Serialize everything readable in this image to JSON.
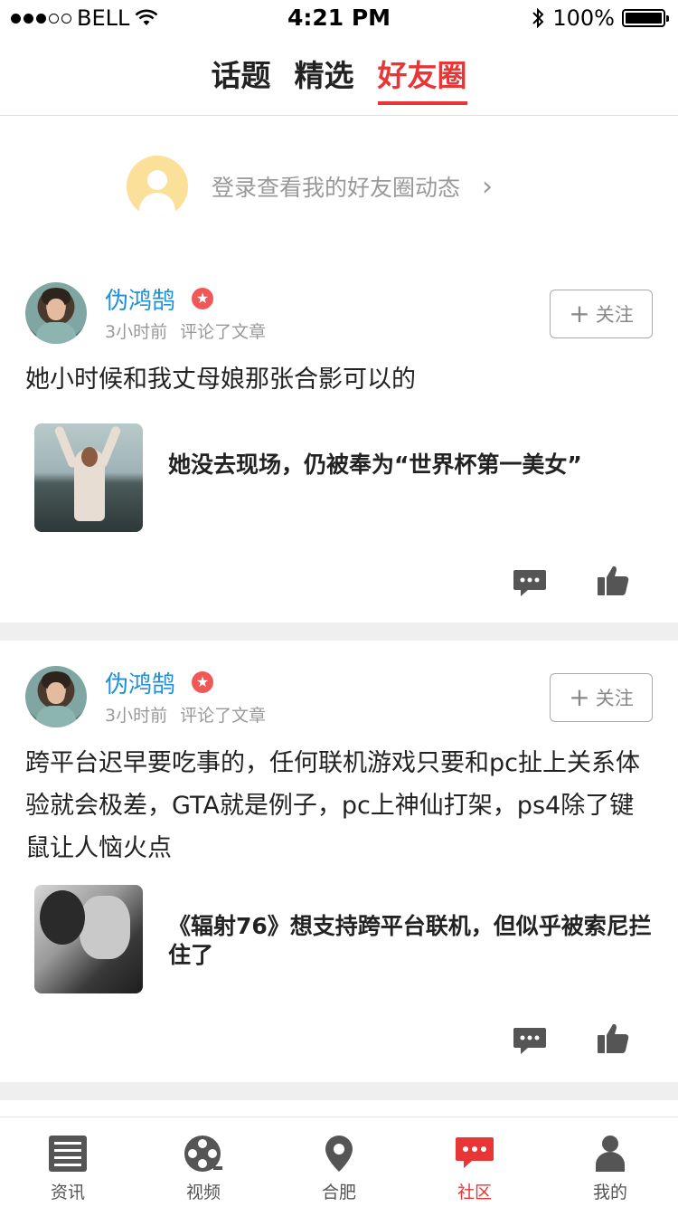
{
  "status_bar": {
    "carrier": "BELL",
    "time": "4:21 PM",
    "battery": "100%",
    "signal_dots_on": 3,
    "signal_dots_total": 5
  },
  "top_tabs": [
    {
      "label": "话题",
      "active": false
    },
    {
      "label": "精选",
      "active": false
    },
    {
      "label": "好友圈",
      "active": true
    }
  ],
  "login_prompt": {
    "text": "登录查看我的好友圈动态"
  },
  "posts": [
    {
      "username": "伪鸿鹄",
      "vip_badge": "★",
      "time": "3小时前",
      "action": "评论了文章",
      "follow_label": "关注",
      "text": "她小时候和我丈母娘那张合影可以的",
      "article_title": "她没去现场，仍被奉为“世界杯第一美女”"
    },
    {
      "username": "伪鸿鹄",
      "vip_badge": "★",
      "time": "3小时前",
      "action": "评论了文章",
      "follow_label": "关注",
      "text": "跨平台迟早要吃事的，任何联机游戏只要和pc扯上关系体验就会极差，GTA就是例子，pc上神仙打架，ps4除了键鼠让人恼火点",
      "article_title": "《辐射76》想支持跨平台联机，但似乎被索尼拦住了"
    }
  ],
  "tab_bar": [
    {
      "label": "资讯",
      "icon": "news-icon",
      "active": false
    },
    {
      "label": "视频",
      "icon": "film-reel-icon",
      "active": false
    },
    {
      "label": "合肥",
      "icon": "location-pin-icon",
      "active": false
    },
    {
      "label": "社区",
      "icon": "chat-bubble-icon",
      "active": true
    },
    {
      "label": "我的",
      "icon": "person-icon",
      "active": false
    }
  ],
  "colors": {
    "accent": "#e83535",
    "link": "#1e90d6",
    "muted": "#999999",
    "separator": "#efefef"
  }
}
